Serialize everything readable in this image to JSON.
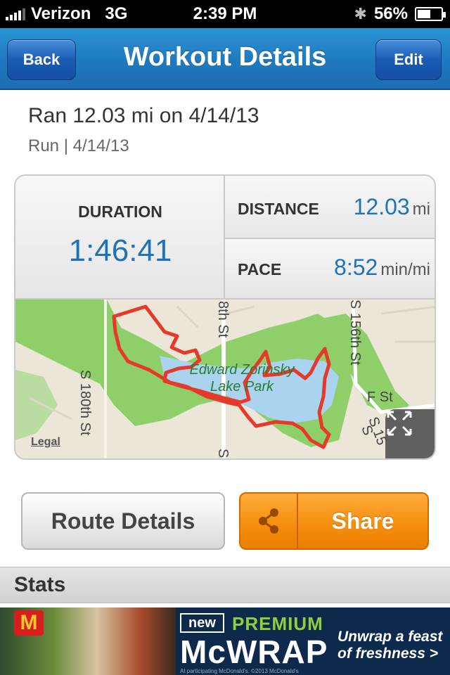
{
  "status_bar": {
    "carrier": "Verizon",
    "network": "3G",
    "time": "2:39 PM",
    "battery": "56%",
    "battery_level": 0.56
  },
  "nav": {
    "back_label": "Back",
    "title": "Workout Details",
    "edit_label": "Edit"
  },
  "workout": {
    "title": "Ran 12.03 mi on 4/14/13",
    "subtitle": "Run | 4/14/13"
  },
  "stats": {
    "duration_label": "DURATION",
    "duration_value": "1:46:41",
    "distance_label": "DISTANCE",
    "distance_value": "12.03",
    "distance_unit": "mi",
    "pace_label": "PACE",
    "pace_value": "8:52",
    "pace_unit": "min/mi"
  },
  "map": {
    "street_1": "S 180th St",
    "street_2": "8th St",
    "street_3": "S 156th St",
    "street_4": "F St",
    "street_5": "S 15",
    "street_6": "S",
    "street_7": "S",
    "park_line1": "Edward Zorinsky",
    "park_line2": "Lake Park",
    "legal": "Legal"
  },
  "buttons": {
    "route_details": "Route Details",
    "share": "Share"
  },
  "section": {
    "stats_header": "Stats"
  },
  "ad": {
    "new": "new",
    "premium": "PREMIUM",
    "product": "McWRAP",
    "tagline_1": "Unwrap a feast",
    "tagline_2": "of freshness >",
    "fine_print": "At participating McDonald's. ©2013 McDonald's"
  },
  "colors": {
    "nav_blue": "#1f79bf",
    "value_blue": "#1e72b8",
    "share_orange": "#f58f0f",
    "route_red": "#e53a2a",
    "park_green": "#8fcf6a",
    "lake_blue": "#a9d3ef"
  }
}
